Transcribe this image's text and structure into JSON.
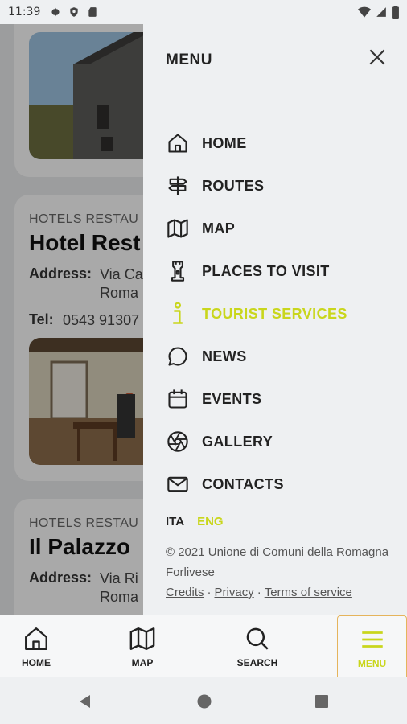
{
  "status_bar": {
    "time": "11:39"
  },
  "background": {
    "cards": [
      {
        "category": "HOTELS RESTAU",
        "title": "Hotel Rest",
        "address_label": "Address:",
        "address_value": "Via Ca\nRoma",
        "tel_label": "Tel:",
        "tel_value": "0543 91307"
      },
      {
        "category": "HOTELS RESTAU",
        "title": "Il Palazzo",
        "address_label": "Address:",
        "address_value": "Via Ri\nRoma"
      }
    ]
  },
  "drawer": {
    "title": "MENU",
    "items": [
      {
        "label": "HOME",
        "icon": "home-icon"
      },
      {
        "label": "ROUTES",
        "icon": "signpost-icon"
      },
      {
        "label": "MAP",
        "icon": "map-icon"
      },
      {
        "label": "PLACES TO VISIT",
        "icon": "tower-icon"
      },
      {
        "label": "TOURIST SERVICES",
        "icon": "info-icon",
        "active": true
      },
      {
        "label": "NEWS",
        "icon": "chat-bubble-icon"
      },
      {
        "label": "EVENTS",
        "icon": "calendar-icon"
      },
      {
        "label": "GALLERY",
        "icon": "aperture-icon"
      },
      {
        "label": "CONTACTS",
        "icon": "envelope-icon"
      }
    ],
    "languages": {
      "ita": "ITA",
      "eng": "ENG"
    },
    "footer": {
      "copyright": "© 2021 Unione di Comuni della Romagna Forlivese",
      "credits": "Credits",
      "privacy": "Privacy",
      "terms": "Terms of service",
      "separator": "·"
    }
  },
  "tabbar": {
    "home": "HOME",
    "map": "MAP",
    "search": "SEARCH",
    "menu": "MENU"
  },
  "colors": {
    "accent": "#c9d61c",
    "active_tab_border": "#e5b45c"
  }
}
